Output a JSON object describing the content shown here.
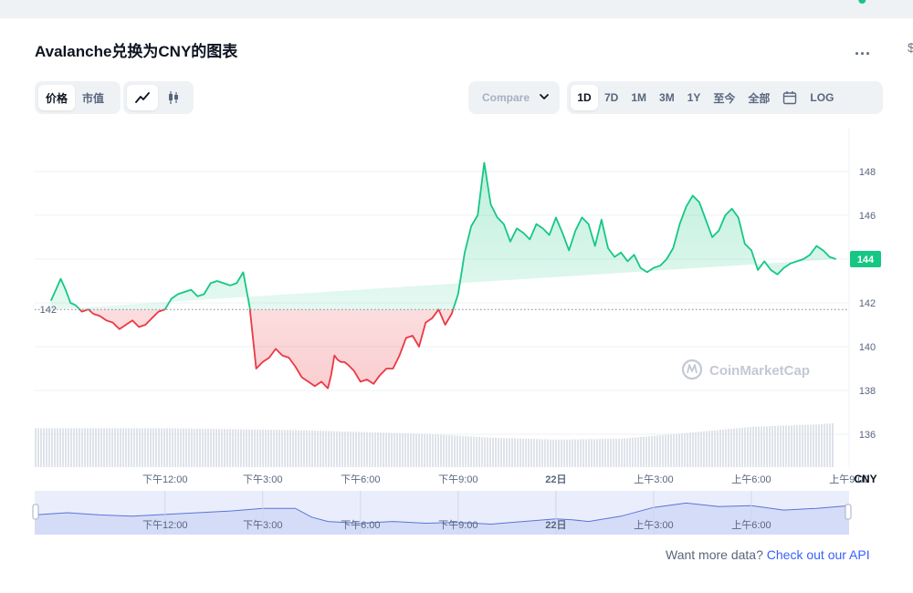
{
  "header": {
    "title": "Avalanche兑换为CNY的图表",
    "more_label": "...",
    "edge_mark": "$"
  },
  "toolbar": {
    "metric_tabs": [
      {
        "label": "价格",
        "active": true
      },
      {
        "label": "市值",
        "active": false
      }
    ],
    "chart_type_icons": [
      {
        "icon": "line-chart-icon",
        "active": true
      },
      {
        "icon": "candlestick-icon",
        "active": false
      }
    ],
    "compare_placeholder": "Compare",
    "compare_icon": "chevron-down-icon",
    "ranges": [
      {
        "label": "1D",
        "active": true
      },
      {
        "label": "7D",
        "active": false
      },
      {
        "label": "1M",
        "active": false
      },
      {
        "label": "3M",
        "active": false
      },
      {
        "label": "1Y",
        "active": false
      },
      {
        "label": "至今",
        "active": false
      },
      {
        "label": "全部",
        "active": false
      }
    ],
    "calendar_icon": "calendar-icon",
    "log_label": "LOG"
  },
  "chart_data": {
    "type": "line",
    "currency": "CNY",
    "ylim": [
      134.5,
      150
    ],
    "y_ticks": [
      136,
      138,
      140,
      142,
      144,
      146,
      148
    ],
    "x_ticks": [
      "下午12:00",
      "下午3:00",
      "下午6:00",
      "下午9:00",
      "22日",
      "上午3:00",
      "上午6:00",
      "上午9:00"
    ],
    "x_tick_hours": [
      12,
      15,
      18,
      21,
      24,
      27,
      30,
      33
    ],
    "x_range_hours": [
      8.0,
      33.0
    ],
    "baseline": 141.7,
    "baseline_label": "142",
    "current_value": 144.0,
    "current_label": "144",
    "up_color": "#16c784",
    "down_color": "#ea3943",
    "watermark": "CoinMarketCap",
    "price_series": {
      "x_hours": [
        8.5,
        8.65,
        8.8,
        8.95,
        9.1,
        9.25,
        9.45,
        9.65,
        9.8,
        10.0,
        10.2,
        10.4,
        10.6,
        10.8,
        11.0,
        11.2,
        11.4,
        11.6,
        11.8,
        12.0,
        12.2,
        12.4,
        12.6,
        12.8,
        13.0,
        13.2,
        13.4,
        13.6,
        13.8,
        14.0,
        14.2,
        14.4,
        14.6,
        14.8,
        15.0,
        15.2,
        15.4,
        15.6,
        15.8,
        16.0,
        16.2,
        16.4,
        16.6,
        16.8,
        17.0,
        17.1,
        17.2,
        17.3,
        17.4,
        17.5,
        17.6,
        17.8,
        18.0,
        18.2,
        18.4,
        18.6,
        18.8,
        19.0,
        19.2,
        19.4,
        19.6,
        19.8,
        20.0,
        20.2,
        20.4,
        20.6,
        20.8,
        21.0,
        21.2,
        21.4,
        21.6,
        21.8,
        22.0,
        22.2,
        22.4,
        22.6,
        22.8,
        23.0,
        23.2,
        23.4,
        23.6,
        23.8,
        24.0,
        24.2,
        24.4,
        24.6,
        24.8,
        25.0,
        25.2,
        25.4,
        25.6,
        25.8,
        26.0,
        26.2,
        26.4,
        26.6,
        26.8,
        27.0,
        27.2,
        27.4,
        27.6,
        27.8,
        28.0,
        28.2,
        28.4,
        28.6,
        28.8,
        29.0,
        29.2,
        29.4,
        29.6,
        29.8,
        30.0,
        30.2,
        30.4,
        30.6,
        30.8,
        31.0,
        31.2,
        31.4,
        31.6,
        31.8,
        32.0,
        32.2,
        32.4,
        32.6,
        32.8,
        33.0,
        33.2,
        33.4
      ],
      "values": [
        142.1,
        142.6,
        143.1,
        142.6,
        142.0,
        141.9,
        141.6,
        141.7,
        141.5,
        141.4,
        141.2,
        141.1,
        140.8,
        141.0,
        141.2,
        140.9,
        141.0,
        141.3,
        141.6,
        141.7,
        142.2,
        142.4,
        142.5,
        142.6,
        142.3,
        142.4,
        142.9,
        143.0,
        142.9,
        142.8,
        142.9,
        143.4,
        141.8,
        139.0,
        139.3,
        139.5,
        139.9,
        139.6,
        139.5,
        139.1,
        138.6,
        138.4,
        138.2,
        138.4,
        138.1,
        138.7,
        139.6,
        139.4,
        139.3,
        139.3,
        139.2,
        138.9,
        138.4,
        138.5,
        138.3,
        138.7,
        139.0,
        139.0,
        139.6,
        140.4,
        140.5,
        140.0,
        141.1,
        141.3,
        141.7,
        141.0,
        141.5,
        142.4,
        144.3,
        145.5,
        146.0,
        148.4,
        146.5,
        145.9,
        145.6,
        144.8,
        145.4,
        145.2,
        144.9,
        145.6,
        145.4,
        145.1,
        145.9,
        145.2,
        144.4,
        145.3,
        145.9,
        145.6,
        144.6,
        145.8,
        144.5,
        144.1,
        144.3,
        143.9,
        144.2,
        143.6,
        143.4,
        143.6,
        143.7,
        144.0,
        144.5,
        145.6,
        146.4,
        146.9,
        146.6,
        145.8,
        145.0,
        145.3,
        146.0,
        146.3,
        145.9,
        144.7,
        144.4,
        143.5,
        143.9,
        143.5,
        143.3,
        143.6,
        143.8,
        143.9,
        144.0,
        144.2,
        144.6,
        144.4,
        144.1,
        144.0
      ]
    },
    "navigator": {
      "x_hours": [
        8.0,
        9.0,
        10.0,
        11.0,
        12.0,
        13.0,
        14.0,
        15.0,
        16.0,
        16.5,
        17.0,
        18.0,
        19.0,
        20.0,
        21.0,
        22.0,
        23.0,
        24.0,
        24.5,
        25.0,
        26.0,
        27.0,
        28.0,
        29.0,
        30.0,
        31.0,
        32.0,
        33.0
      ],
      "values": [
        0.45,
        0.5,
        0.45,
        0.42,
        0.46,
        0.5,
        0.54,
        0.6,
        0.6,
        0.4,
        0.3,
        0.26,
        0.3,
        0.26,
        0.28,
        0.24,
        0.3,
        0.36,
        0.34,
        0.3,
        0.42,
        0.62,
        0.72,
        0.64,
        0.66,
        0.56,
        0.6,
        0.66
      ]
    },
    "volume_profile": {
      "x_hours": [
        8.0,
        12.0,
        16.0,
        18.0,
        20.0,
        22.0,
        24.0,
        26.0,
        28.0,
        30.0,
        32.0,
        33.0
      ],
      "values": [
        0.82,
        0.82,
        0.78,
        0.74,
        0.7,
        0.62,
        0.58,
        0.6,
        0.72,
        0.85,
        0.9,
        0.95
      ]
    }
  },
  "navigator_labels": [
    "下午12:00",
    "下午3:00",
    "下午6:00",
    "下午9:00",
    "22日",
    "上午3:00",
    "上午6:00"
  ],
  "footer": {
    "prompt": "Want more data?",
    "link": "Check out our API"
  }
}
